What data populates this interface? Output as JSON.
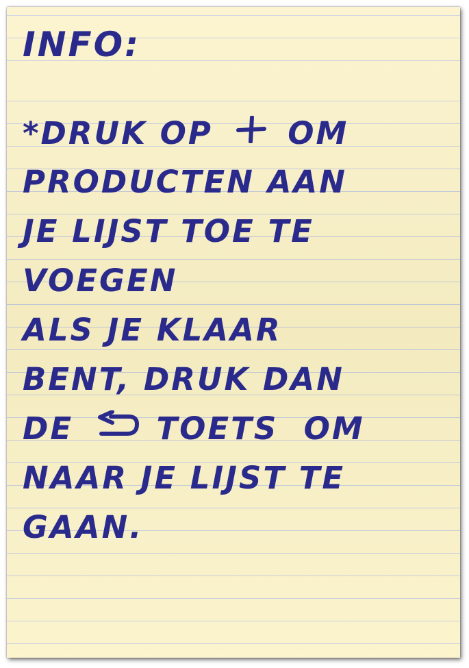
{
  "note": {
    "heading": "INFO:",
    "lines": [
      {
        "before": "*DRUK OP",
        "icon": "plus-icon",
        "after": "OM"
      },
      {
        "text": "PRODUCTEN AAN"
      },
      {
        "text": "JE LIJST TOE TE"
      },
      {
        "text": "VOEGEN"
      },
      {
        "text": "ALS JE KLAAR"
      },
      {
        "text": "BENT, DRUK DAN"
      },
      {
        "before": "DE",
        "icon": "back-arrow-icon",
        "after": "TOETS  OM"
      },
      {
        "text": "NAAR JE LIJST TE"
      },
      {
        "text": "GAAN."
      }
    ],
    "ink_color": "#2a2a8c",
    "paper_color": "#fbf2c6",
    "rule_color": "#c4cadc"
  }
}
